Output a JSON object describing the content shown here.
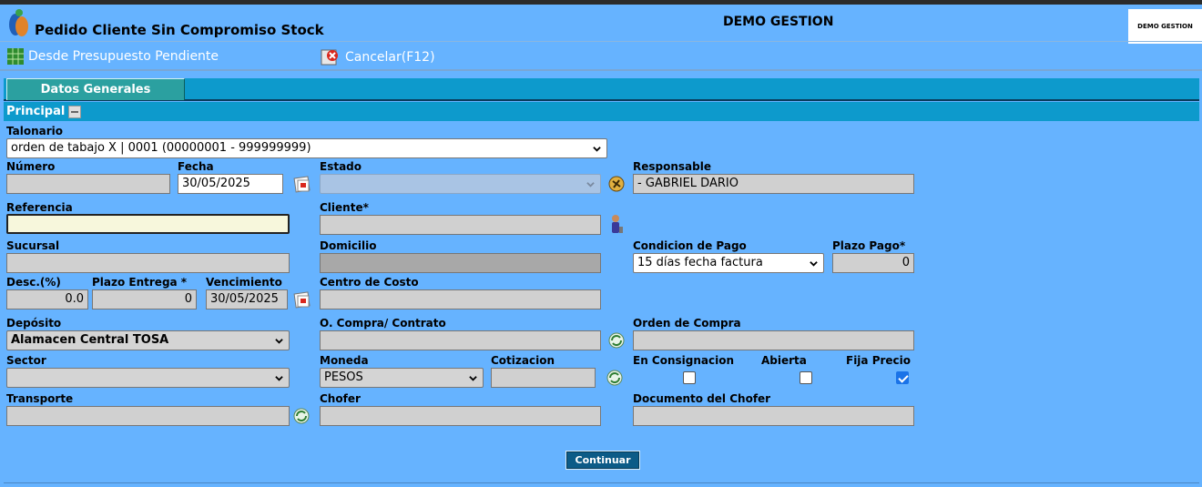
{
  "header": {
    "page_title": "Pedido Cliente Sin Compromiso Stock",
    "company_name": "DEMO GESTION",
    "company_logo_text": "DEMO GESTION"
  },
  "toolbar": {
    "presupuesto_label": "Desde Presupuesto Pendiente",
    "cancel_label": "Cancelar(F12)"
  },
  "tabs": [
    {
      "label": "Datos Generales"
    }
  ],
  "section": {
    "title": "Principal"
  },
  "form": {
    "talonario": {
      "label": "Talonario",
      "value": "orden de tabajo X | 0001 (00000001 - 999999999)"
    },
    "numero": {
      "label": "Número",
      "value": ""
    },
    "fecha": {
      "label": "Fecha",
      "value": "30/05/2025"
    },
    "estado": {
      "label": "Estado",
      "value": ""
    },
    "responsable": {
      "label": "Responsable",
      "value": "- GABRIEL DARIO"
    },
    "referencia": {
      "label": "Referencia",
      "value": ""
    },
    "cliente": {
      "label": "Cliente*",
      "value": ""
    },
    "sucursal": {
      "label": "Sucursal",
      "value": ""
    },
    "domicilio": {
      "label": "Domicilio",
      "value": ""
    },
    "condicion_pago": {
      "label": "Condicion de Pago",
      "value": "15 días fecha factura"
    },
    "plazo_pago": {
      "label": "Plazo Pago*",
      "value": "0"
    },
    "desc": {
      "label": "Desc.(%)",
      "value": "0.0"
    },
    "plazo_entrega": {
      "label": "Plazo Entrega *",
      "value": "0"
    },
    "vencimiento": {
      "label": "Vencimiento",
      "value": "30/05/2025"
    },
    "centro_costo": {
      "label": "Centro de Costo",
      "value": ""
    },
    "deposito": {
      "label": "Depósito",
      "value": "Alamacen Central TOSA"
    },
    "compra_contrato": {
      "label": "O. Compra/ Contrato",
      "value": ""
    },
    "orden_compra": {
      "label": "Orden de Compra",
      "value": ""
    },
    "sector": {
      "label": "Sector",
      "value": ""
    },
    "moneda": {
      "label": "Moneda",
      "value": "PESOS"
    },
    "cotizacion": {
      "label": "Cotizacion",
      "value": ""
    },
    "en_consignacion": {
      "label": "En Consignacion",
      "checked": false
    },
    "abierta": {
      "label": "Abierta",
      "checked": false
    },
    "fija_precio": {
      "label": "Fija Precio",
      "checked": true
    },
    "transporte": {
      "label": "Transporte",
      "value": ""
    },
    "chofer": {
      "label": "Chofer",
      "value": ""
    },
    "documento_chofer": {
      "label": "Documento del Chofer",
      "value": ""
    }
  },
  "actions": {
    "continue_label": "Continuar"
  },
  "icons": {
    "logo": "app-logo-icon",
    "grid": "grid-icon",
    "cancel": "cancel-icon",
    "calendar": "calendar-icon",
    "search": "search-icon",
    "person": "person-icon",
    "refresh": "refresh-icon"
  }
}
